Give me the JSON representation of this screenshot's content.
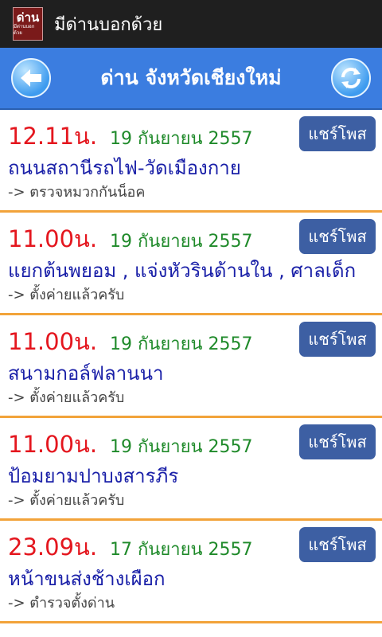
{
  "app": {
    "logo_text": "ด่าน",
    "logo_sub": "มีด่านบอกด้วย",
    "title": "มีด่านบอกด้วย"
  },
  "toolbar": {
    "back_icon": "back-arrow-icon",
    "title": "ด่าน จังหวัดเชียงใหม่",
    "refresh_icon": "refresh-icon"
  },
  "share_label": "แชร์โพส",
  "items": [
    {
      "time": "12.11น.",
      "date": "19 กันยายน 2557",
      "location": "ถนนสถานีรถไฟ-วัดเมืองกาย",
      "note": "-> ตรวจหมวกกันน็อค"
    },
    {
      "time": "11.00น.",
      "date": "19 กันยายน 2557",
      "location": "แยกต้นพยอม , แจ่งหัวรินด้านใน , ศาลเด็ก",
      "note": "-> ตั้งค่ายแล้วครับ"
    },
    {
      "time": "11.00น.",
      "date": "19 กันยายน 2557",
      "location": "สนามกอล์ฟลานนา",
      "note": "-> ตั้งค่ายแล้วครับ"
    },
    {
      "time": "11.00น.",
      "date": "19 กันยายน 2557",
      "location": "ป้อมยามปาบงสารภีร",
      "note": "-> ตั้งค่ายแล้วครับ"
    },
    {
      "time": "23.09น.",
      "date": "17 กันยายน 2557",
      "location": "หน้าขนส่งช้างเผือก",
      "note": "-> ตำรวจตั้งด่าน"
    }
  ]
}
